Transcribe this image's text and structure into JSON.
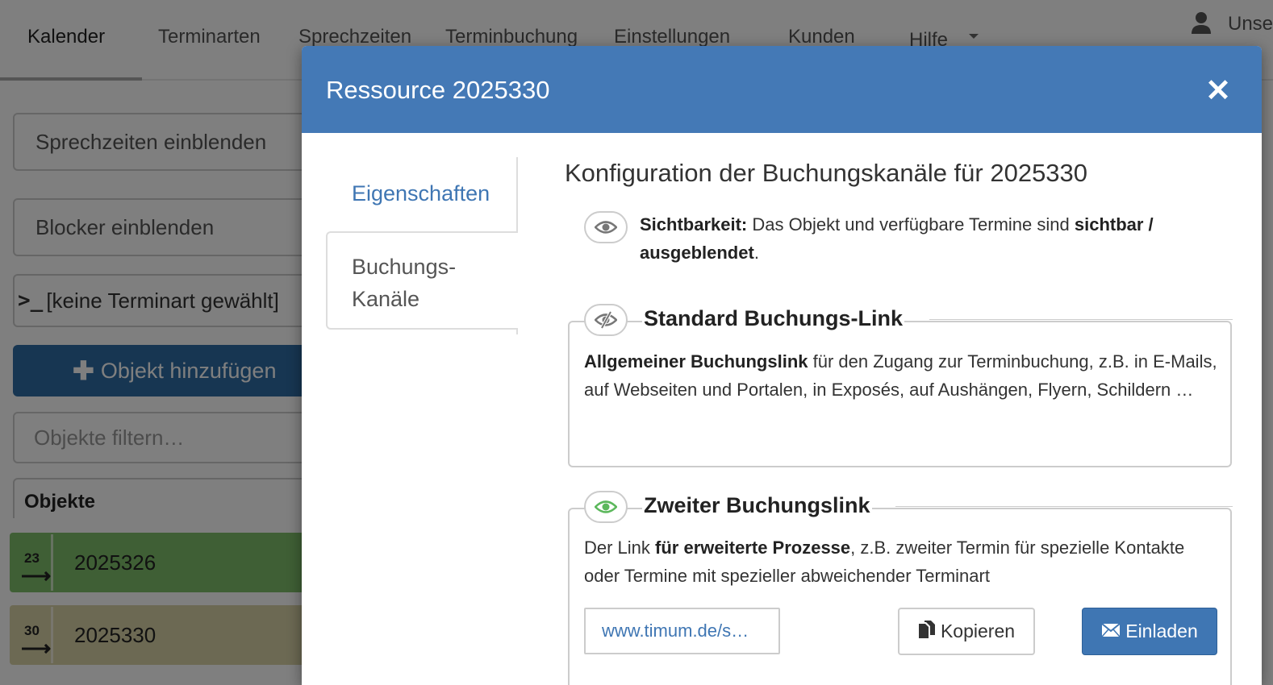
{
  "nav": {
    "items": [
      "Kalender",
      "Terminarten",
      "Sprechzeiten",
      "Terminbuchung",
      "Einstellungen",
      "Kunden",
      "Hilfe"
    ],
    "user_name": "Unse"
  },
  "sidebar": {
    "show_office_hours": "Sprechzeiten einblenden",
    "show_blockers": "Blocker einblenden",
    "terminal_glyph": ">_",
    "appointment_type": "[keine Terminart gewählt]",
    "add_object": "Objekt hinzufügen",
    "filter_placeholder": "Objekte filtern…",
    "objects_heading": "Objekte",
    "objects": [
      {
        "badge": "23",
        "name": "2025326",
        "color": "#7fbf6a"
      },
      {
        "badge": "30",
        "name": "2025330",
        "color": "#d9d3a6"
      }
    ]
  },
  "modal": {
    "title": "Ressource 2025330",
    "close_symbol": "✕",
    "header_color": "#4479b6",
    "tabs": [
      "Eigenschaften",
      "Buchungs-\nKanäle"
    ],
    "content_title": "Konfiguration der Buchungskanäle für 2025330",
    "visibility": {
      "label": "Sichtbarkeit:",
      "text": " Das Objekt und verfügbare Termine sind ",
      "state": "sichtbar / ausgeblendet",
      "end": "."
    },
    "standard_link": {
      "title": "Standard Buchungs-Link",
      "desc_bold": "Allgemeiner Buchungslink",
      "desc": " für den Zugang zur Terminbuchung, z.B. in E-Mails, auf Webseiten und Portalen, in Exposés, auf Aushängen, Flyern, Schildern …"
    },
    "second_link": {
      "title": "Zweiter Buchungslink",
      "desc_pre": "Der Link ",
      "desc_bold": "für erweiterte Prozesse",
      "desc_post": ", z.B. zweiter Termin für spezielle Kontakte oder Termine mit spezieller abweichender Terminart",
      "url": "www.timum.de/s…",
      "copy_label": "Kopieren",
      "invite_label": "Einladen",
      "accent_color": "#5cb85c"
    }
  }
}
